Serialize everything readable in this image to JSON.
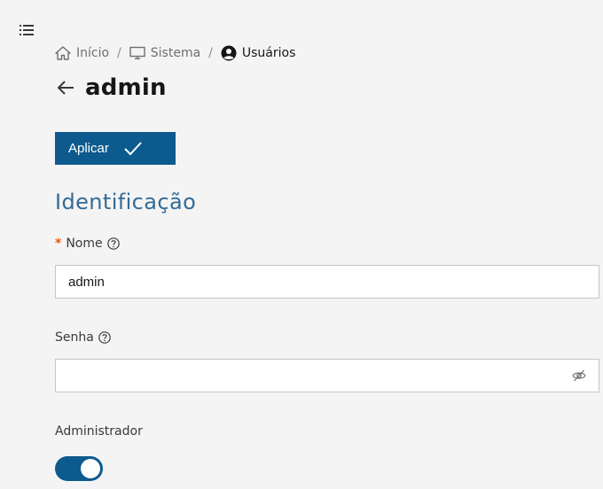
{
  "icons": {
    "menu": "list-menu-icon",
    "home": "home-icon",
    "system": "monitor-icon",
    "users": "user-circle-icon",
    "back": "arrow-left-icon",
    "apply": "checkmark-icon",
    "help": "help-circle-icon",
    "password_visibility": "eye-off-icon"
  },
  "colors": {
    "primary": "#0d5a8f",
    "section_title": "#336b96",
    "required": "#e8590c"
  },
  "breadcrumb": {
    "items": [
      {
        "label": "Início",
        "icon": "home-icon"
      },
      {
        "label": "Sistema",
        "icon": "monitor-icon"
      },
      {
        "label": "Usuários",
        "icon": "user-circle-icon"
      }
    ],
    "separator": "/"
  },
  "header": {
    "title": "admin"
  },
  "toolbar": {
    "apply_label": "Aplicar"
  },
  "form": {
    "section_title": "Identificação",
    "name": {
      "required_mark": "*",
      "label": "Nome",
      "value": "admin"
    },
    "password": {
      "label": "Senha",
      "value": ""
    },
    "admin": {
      "label": "Administrador",
      "enabled": true
    }
  }
}
